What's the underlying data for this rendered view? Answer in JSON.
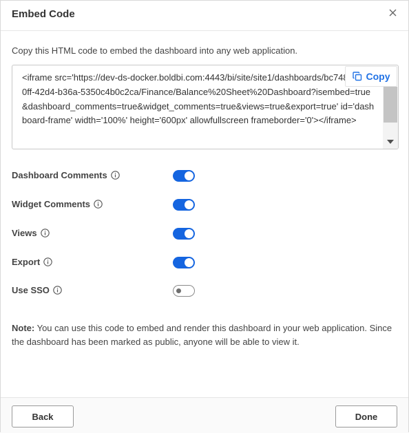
{
  "dialog": {
    "title": "Embed Code",
    "description": "Copy this HTML code to embed the dashboard into any web application.",
    "code": "<iframe src='https://dev-ds-docker.boldbi.com:4443/bi/site/site1/dashboards/bc748aa5-50ff-42d4-b36a-5350c4b0c2ca/Finance/Balance%20Sheet%20Dashboard?isembed=true&dashboard_comments=true&widget_comments=true&views=true&export=true' id='dashboard-frame' width='100%' height='600px' allowfullscreen frameborder='0'></iframe>",
    "copy_label": "Copy",
    "options": [
      {
        "label": "Dashboard Comments",
        "enabled": true
      },
      {
        "label": "Widget Comments",
        "enabled": true
      },
      {
        "label": "Views",
        "enabled": true
      },
      {
        "label": "Export",
        "enabled": true
      },
      {
        "label": "Use SSO",
        "enabled": false
      }
    ],
    "note_label": "Note:",
    "note_text": " You can use this code to embed and render this dashboard in your web application. Since the dashboard has been marked as public, anyone will be able to view it.",
    "back_label": "Back",
    "done_label": "Done"
  },
  "icons": {
    "close": "close-icon",
    "copy": "copy-icon",
    "info": "info-icon",
    "scroll_down": "chevron-down-icon"
  },
  "colors": {
    "accent": "#1565e0",
    "copy_text": "#2172e5"
  }
}
